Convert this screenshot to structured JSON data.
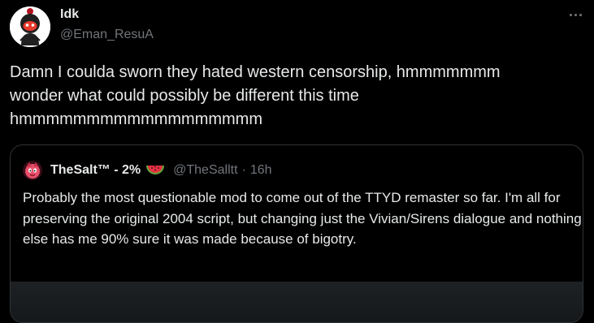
{
  "tweet": {
    "author": {
      "display_name": "Idk",
      "handle": "@Eman_ResuA",
      "avatar_icon": "ninja-avatar-icon"
    },
    "text": "Damn I coulda sworn they hated western censorship, hmmmmmmm\nwonder what could possibly be different this time\nhmmmmmmmmmmmmmmmmmm",
    "more_icon": "more-dots-icon"
  },
  "quote": {
    "author": {
      "display_name": "TheSalt™ - 2%",
      "emoji_icon": "watermelon-icon",
      "handle": "@TheSalltt",
      "separator": "·",
      "time": "16h",
      "avatar_icon": "pink-character-avatar-icon"
    },
    "text": "Probably the most questionable mod to come out of the TTYD remaster so far. I'm all for preserving the original 2004 script, but changing just the Vivian/Sirens dialogue and nothing else has me 90% sure it was made because of bigotry."
  },
  "colors": {
    "background": "#000000",
    "text_primary": "#e7e9ea",
    "text_secondary": "#71767b",
    "border": "#2f3336"
  }
}
